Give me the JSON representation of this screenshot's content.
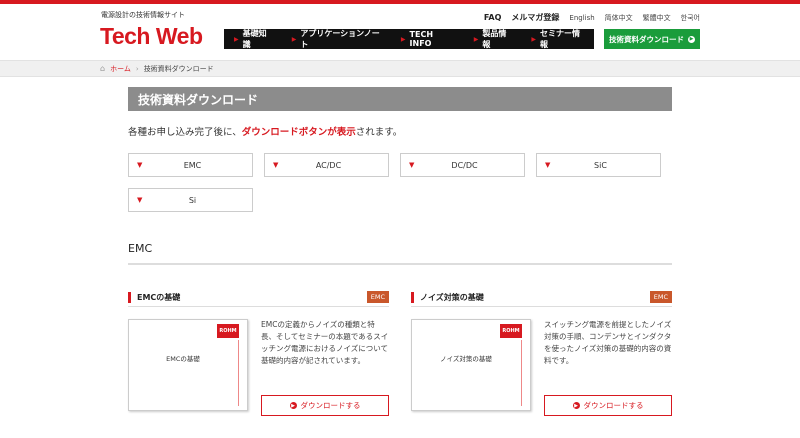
{
  "header": {
    "tagline": "電源設計の技術情報サイト",
    "logo": "Tech Web",
    "util": {
      "faq": "FAQ",
      "newsletter": "メルマガ登録",
      "lang_en": "English",
      "lang_zh_cn": "简体中文",
      "lang_zh_tw": "繁體中文",
      "lang_ko": "한국어"
    },
    "nav": [
      "基礎知識",
      "アプリケーションノート",
      "TECH INFO",
      "製品情報",
      "セミナー情報"
    ],
    "download_button": "技術資料ダウンロード"
  },
  "breadcrumb": {
    "home": "ホーム",
    "separator": "›",
    "current": "技術資料ダウンロード"
  },
  "main": {
    "title": "技術資料ダウンロード",
    "intro_before": "各種お申し込み完了後に、",
    "intro_highlight": "ダウンロードボタンが表示",
    "intro_after": "されます。",
    "categories": [
      "EMC",
      "AC/DC",
      "DC/DC",
      "SiC",
      "Si"
    ],
    "section_title": "EMC",
    "cards": [
      {
        "title": "EMCの基礎",
        "badge": "EMC",
        "thumb_title": "EMCの基礎",
        "thumb_logo": "ROHM",
        "description": "EMCの定義からノイズの種類と特長、そしてセミナーの本題であるスイッチング電源におけるノイズについて基礎的内容が記されています。",
        "button": "ダウンロードする"
      },
      {
        "title": "ノイズ対策の基礎",
        "badge": "EMC",
        "thumb_title": "ノイズ対策の基礎",
        "thumb_logo": "ROHM",
        "description": "スイッチング電源を前提としたノイズ対策の手順、コンデンサとインダクタを使ったノイズ対策の基礎的内容の資料です。",
        "button": "ダウンロードする"
      }
    ]
  },
  "colors": {
    "brand_red": "#d71920",
    "green": "#1a9c3b",
    "title_gray": "#8c8c8c",
    "badge_orange": "#c9572b"
  }
}
